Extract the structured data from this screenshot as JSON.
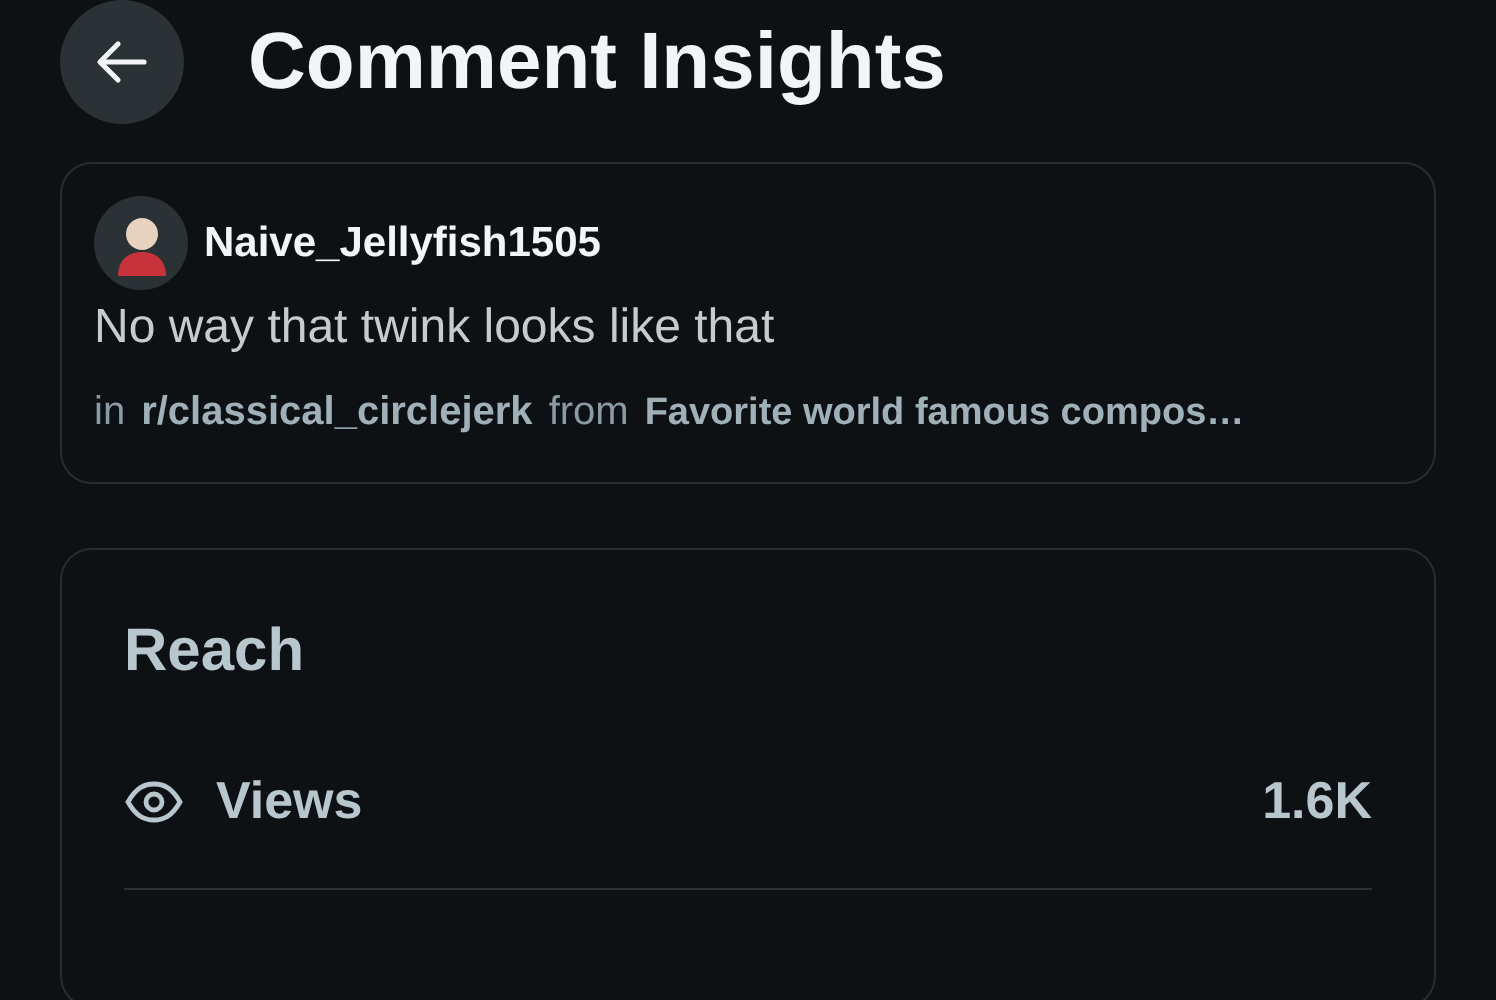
{
  "header": {
    "title": "Comment Insights"
  },
  "comment": {
    "username": "Naive_Jellyfish1505",
    "body": "No way that twink looks like that",
    "prefix": "in",
    "subreddit": "r/classical_circlejerk",
    "joiner": "from",
    "post_title": "Favorite world famous compos…"
  },
  "reach": {
    "title": "Reach",
    "stats": [
      {
        "label": "Views",
        "value": "1.6K"
      }
    ]
  }
}
